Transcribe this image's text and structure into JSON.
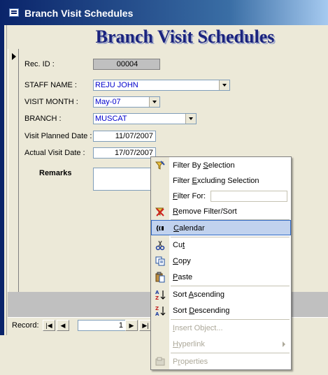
{
  "window": {
    "title": "Branch Visit Schedules"
  },
  "form": {
    "heading": "Branch Visit Schedules",
    "rec_id": {
      "label": "Rec. ID :",
      "value": "00004"
    },
    "staff_name": {
      "label": "STAFF  NAME :",
      "value": "REJU JOHN"
    },
    "visit_month": {
      "label": "VISIT MONTH :",
      "value": "May-07"
    },
    "branch": {
      "label": "BRANCH :",
      "value": "MUSCAT"
    },
    "visit_planned_date": {
      "label": "Visit Planned Date :",
      "value": "11/07/2007"
    },
    "actual_visit_date": {
      "label": "Actual Visit Date :",
      "value": "17/07/2007"
    },
    "remarks": {
      "label": "Remarks"
    }
  },
  "navigation": {
    "record_label": "Record:",
    "record_number": "1"
  },
  "context_menu": {
    "items": [
      {
        "pre": "Filter By ",
        "u": "S",
        "post": "election",
        "icon": "filter-by-selection-icon",
        "enabled": true
      },
      {
        "pre": "Filter ",
        "u": "E",
        "post": "xcluding Selection",
        "icon": "",
        "enabled": true
      },
      {
        "pre": "",
        "u": "F",
        "post": "ilter For:",
        "icon": "",
        "enabled": true
      },
      {
        "pre": "",
        "u": "R",
        "post": "emove Filter/Sort",
        "icon": "remove-filter-icon",
        "enabled": true
      },
      {
        "pre": "",
        "u": "C",
        "post": "alendar",
        "icon": "calendar-icon",
        "enabled": true,
        "selected": true
      },
      {
        "pre": "Cu",
        "u": "t",
        "post": "",
        "icon": "scissors-icon",
        "enabled": true
      },
      {
        "pre": "",
        "u": "C",
        "post": "opy",
        "icon": "copy-icon",
        "enabled": true
      },
      {
        "pre": "",
        "u": "P",
        "post": "aste",
        "icon": "paste-icon",
        "enabled": true
      },
      {
        "pre": "Sort ",
        "u": "A",
        "post": "scending",
        "icon": "sort-ascending-icon",
        "enabled": true
      },
      {
        "pre": "Sort ",
        "u": "D",
        "post": "escending",
        "icon": "sort-descending-icon",
        "enabled": true
      },
      {
        "pre": "",
        "u": "I",
        "post": "nsert Object...",
        "icon": "",
        "enabled": false
      },
      {
        "pre": "",
        "u": "H",
        "post": "yperlink",
        "icon": "",
        "enabled": false
      },
      {
        "pre": "P",
        "u": "r",
        "post": "operties",
        "icon": "properties-icon",
        "enabled": false
      }
    ]
  },
  "colors": {
    "title_gradient_start": "#0a246a",
    "heading_text": "#1a237e",
    "field_text": "#0000cc",
    "menu_highlight": "#c1d2ee"
  }
}
